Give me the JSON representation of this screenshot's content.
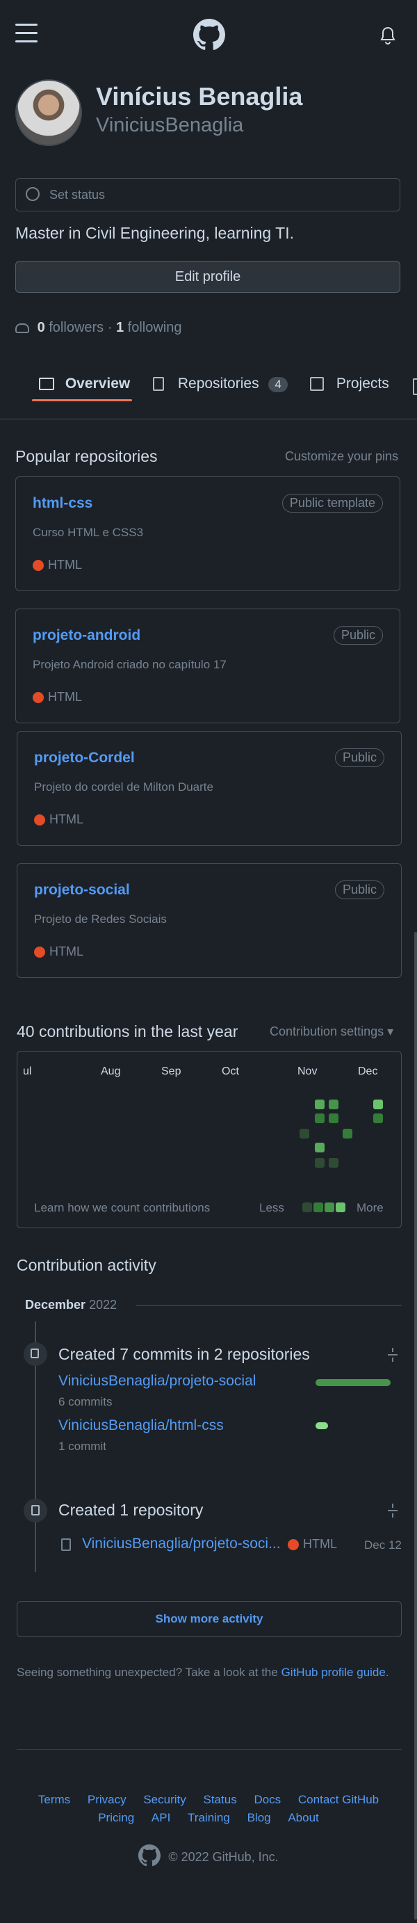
{
  "profile": {
    "name": "Vinícius Benaglia",
    "username": "ViniciusBenaglia",
    "status_placeholder": "Set status",
    "bio": "Master in Civil Engineering, learning TI.",
    "edit_label": "Edit profile",
    "followers_count": "0",
    "followers_label": "followers",
    "separator": "·",
    "following_count": "1",
    "following_label": "following"
  },
  "tabs": [
    {
      "label": "Overview"
    },
    {
      "label": "Repositories",
      "count": "4"
    },
    {
      "label": "Projects"
    }
  ],
  "popular": {
    "title": "Popular repositories",
    "customize": "Customize your pins",
    "repos": [
      {
        "name": "html-css",
        "visibility": "Public template",
        "description": "Curso HTML e CSS3",
        "language": "HTML"
      },
      {
        "name": "projeto-android",
        "visibility": "Public",
        "description": "Projeto Android criado no capítulo 17",
        "language": "HTML"
      },
      {
        "name": "projeto-Cordel",
        "visibility": "Public",
        "description": "Projeto do cordel de Milton Duarte",
        "language": "HTML"
      },
      {
        "name": "projeto-social",
        "visibility": "Public",
        "description": "Projeto de Redes Sociais",
        "language": "HTML"
      }
    ]
  },
  "contributions": {
    "title": "40 contributions in the last year",
    "settings": "Contribution settings ▾",
    "months": [
      "ul",
      "Aug",
      "Sep",
      "Oct",
      "Nov",
      "Dec"
    ],
    "learn": "Learn how we count contributions",
    "less": "Less",
    "more": "More"
  },
  "activity": {
    "title": "Contribution activity",
    "month": "December",
    "year": "2022",
    "commits_title": "Created 7 commits in 2 repositories",
    "commit_repos": [
      {
        "name": "ViniciusBenaglia/projeto-social",
        "count": "6 commits"
      },
      {
        "name": "ViniciusBenaglia/html-css",
        "count": "1 commit"
      }
    ],
    "repo_title": "Created 1 repository",
    "created_repo": {
      "name": "ViniciusBenaglia/projeto-soci...",
      "language": "HTML",
      "date": "Dec 12"
    },
    "show_more": "Show more activity"
  },
  "unexpected": {
    "text": "Seeing something unexpected? Take a look at the ",
    "link": "GitHub profile guide",
    "end": "."
  },
  "footer": {
    "links_row1": [
      "Terms",
      "Privacy",
      "Security",
      "Status",
      "Docs",
      "Contact GitHub"
    ],
    "links_row2": [
      "Pricing",
      "API",
      "Training",
      "Blog",
      "About"
    ],
    "copyright": "© 2022 GitHub, Inc."
  },
  "colors": {
    "accent": "#539bf5",
    "html_lang": "#e34c26",
    "tab_underline": "#ec775c"
  }
}
